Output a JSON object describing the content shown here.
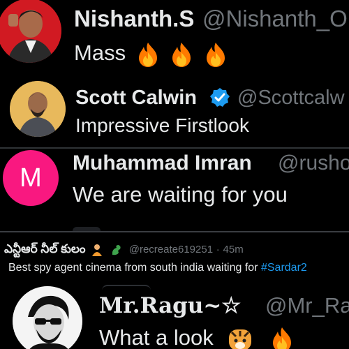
{
  "tweets": [
    {
      "name": "Nishanth.S",
      "handle": "@Nishanth_O",
      "text": "Mass",
      "emoji": [
        "fire-emoji",
        "fire-emoji",
        "fire-emoji"
      ]
    },
    {
      "name": "Scott Calwin",
      "handle": "@Scottcalw",
      "text": "Impressive Firstlook",
      "verified": true
    },
    {
      "name": "Muhammad Imran",
      "handle": "@rusho",
      "text": "We are waiting for you",
      "avatar_letter": "M"
    },
    {
      "name": "ఎన్టీఆర్ నీల్ కులం",
      "name_emoji": [
        "person-emoji",
        "dragon-emoji"
      ],
      "handle": "@recreate619251",
      "time_sep": "·",
      "time": "45m",
      "text": "Best spy agent cinema from south india waiting for ",
      "hashtag": "#Sardar2"
    },
    {
      "name": "Mr.Ragu~☆",
      "handle": "@Mr_Ra",
      "text": "What a look",
      "emoji": [
        "tiger-emoji",
        "fire-emoji"
      ]
    }
  ],
  "colors": {
    "background": "#000000",
    "text": "#e7e9ea",
    "muted": "#71767b",
    "link": "#1d9bf0",
    "avatar_pink": "#f91880",
    "fire": "#ff7a00"
  }
}
